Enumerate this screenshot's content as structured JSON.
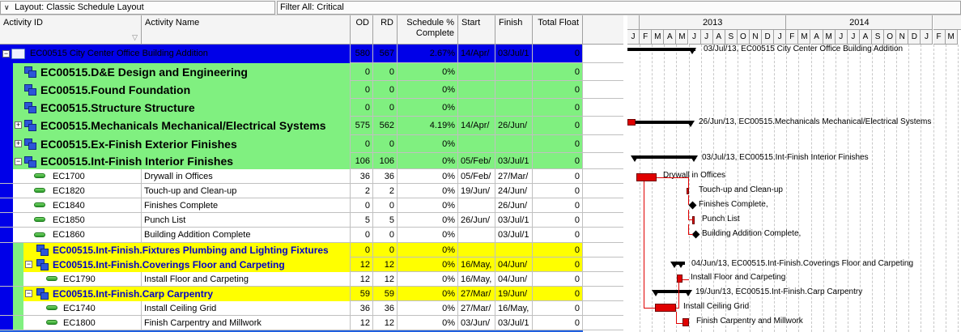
{
  "toolbar": {
    "layout": "Layout: Classic Schedule Layout",
    "filter": "Filter All: Critical"
  },
  "columns": {
    "activity_id": "Activity ID",
    "activity_name": "Activity Name",
    "od": "OD",
    "rd": "RD",
    "sched_pct": "Schedule % Complete",
    "start": "Start",
    "finish": "Finish",
    "total_float": "Total Float"
  },
  "rows": [
    {
      "type": "project",
      "id": "EC00515  City Center Office Building Addition",
      "name": "",
      "od": "580",
      "rd": "567",
      "pct": "2.67%",
      "start": "14/Apr/",
      "finish": "03/Jul/1",
      "tf": "0"
    },
    {
      "type": "wbs1",
      "id": "EC00515.D&E  Design and Engineering",
      "name": "",
      "od": "0",
      "rd": "0",
      "pct": "0%",
      "start": "",
      "finish": "",
      "tf": "0"
    },
    {
      "type": "wbs1",
      "id": "EC00515.Found  Foundation",
      "name": "",
      "od": "0",
      "rd": "0",
      "pct": "0%",
      "start": "",
      "finish": "",
      "tf": "0"
    },
    {
      "type": "wbs1",
      "id": "EC00515.Structure  Structure",
      "name": "",
      "od": "0",
      "rd": "0",
      "pct": "0%",
      "start": "",
      "finish": "",
      "tf": "0"
    },
    {
      "type": "wbs1",
      "id": "EC00515.Mechanicals  Mechanical/Electrical Systems",
      "name": "",
      "od": "575",
      "rd": "562",
      "pct": "4.19%",
      "start": "14/Apr/",
      "finish": "26/Jun/",
      "tf": "0"
    },
    {
      "type": "wbs1",
      "id": "EC00515.Ex-Finish  Exterior Finishes",
      "name": "",
      "od": "0",
      "rd": "0",
      "pct": "0%",
      "start": "",
      "finish": "",
      "tf": "0"
    },
    {
      "type": "wbs1",
      "id": "EC00515.Int-Finish  Interior Finishes",
      "name": "",
      "od": "106",
      "rd": "106",
      "pct": "0%",
      "start": "05/Feb/",
      "finish": "03/Jul/1",
      "tf": "0"
    },
    {
      "type": "act1",
      "id": "EC1700",
      "name": "Drywall in Offices",
      "od": "36",
      "rd": "36",
      "pct": "0%",
      "start": "05/Feb/",
      "finish": "27/Mar/",
      "tf": "0"
    },
    {
      "type": "act1",
      "id": "EC1820",
      "name": "Touch-up and Clean-up",
      "od": "2",
      "rd": "2",
      "pct": "0%",
      "start": "19/Jun/",
      "finish": "24/Jun/",
      "tf": "0"
    },
    {
      "type": "act1",
      "id": "EC1840",
      "name": "Finishes Complete",
      "od": "0",
      "rd": "0",
      "pct": "0%",
      "start": "",
      "finish": "26/Jun/",
      "tf": "0"
    },
    {
      "type": "act1",
      "id": "EC1850",
      "name": "Punch List",
      "od": "5",
      "rd": "5",
      "pct": "0%",
      "start": "26/Jun/",
      "finish": "03/Jul/1",
      "tf": "0"
    },
    {
      "type": "act1",
      "id": "EC1860",
      "name": "Building Addition Complete",
      "od": "0",
      "rd": "0",
      "pct": "0%",
      "start": "",
      "finish": "03/Jul/1",
      "tf": "0"
    },
    {
      "type": "wbs2",
      "id": "EC00515.Int-Finish.Fixtures  Plumbing and Lighting Fixtures",
      "name": "",
      "od": "0",
      "rd": "0",
      "pct": "0%",
      "start": "",
      "finish": "",
      "tf": "0"
    },
    {
      "type": "wbs2",
      "id": "EC00515.Int-Finish.Coverings  Floor and Carpeting",
      "name": "",
      "od": "12",
      "rd": "12",
      "pct": "0%",
      "start": "16/May,",
      "finish": "04/Jun/",
      "tf": "0"
    },
    {
      "type": "act2",
      "id": "EC1790",
      "name": "Install Floor and Carpeting",
      "od": "12",
      "rd": "12",
      "pct": "0%",
      "start": "16/May,",
      "finish": "04/Jun/",
      "tf": "0"
    },
    {
      "type": "wbs2",
      "id": "EC00515.Int-Finish.Carp  Carpentry",
      "name": "",
      "od": "59",
      "rd": "59",
      "pct": "0%",
      "start": "27/Mar/",
      "finish": "19/Jun/",
      "tf": "0"
    },
    {
      "type": "act2",
      "id": "EC1740",
      "name": "Install Ceiling Grid",
      "od": "36",
      "rd": "36",
      "pct": "0%",
      "start": "27/Mar/",
      "finish": "16/May,",
      "tf": "0"
    },
    {
      "type": "act2",
      "id": "EC1800",
      "name": "Finish Carpentry and Millwork",
      "od": "12",
      "rd": "12",
      "pct": "0%",
      "start": "03/Jun/",
      "finish": "03/Jul/1",
      "tf": "0"
    }
  ],
  "gantt": {
    "years": [
      "2013",
      "2014"
    ],
    "months": [
      "J",
      "F",
      "M",
      "A",
      "M",
      "J",
      "J",
      "A",
      "S",
      "O",
      "N",
      "D",
      "J",
      "F",
      "M",
      "A",
      "M",
      "J",
      "J",
      "A",
      "S",
      "O",
      "N",
      "D",
      "J",
      "F",
      "M"
    ],
    "labels": {
      "project": "03/Jul/13, EC00515  City Center Office Building Addition",
      "mech": "26/Jun/13, EC00515.Mechanicals  Mechanical/Electrical Systems",
      "intfin": "03/Jul/13, EC00515.Int-Finish  Interior Finishes",
      "drywall": "Drywall in Offices",
      "touchup": "Touch-up and Clean-up",
      "fincomplete": "Finishes Complete,",
      "punch": "Punch List",
      "bacomplete": "Building Addition Complete,",
      "coverings": "04/Jun/13, EC00515.Int-Finish.Coverings  Floor and Carpeting",
      "floor": "Install Floor and Carpeting",
      "carp": "19/Jun/13, EC00515.Int-Finish.Carp  Carpentry",
      "ceiling": "Install Ceiling Grid",
      "millwork": "Finish Carpentry and Millwork"
    }
  },
  "colors": {
    "project_bg": "#0000e8",
    "wbs1_bg": "#80f080",
    "wbs2_bg": "#ffff00",
    "critical": "#e00000"
  }
}
